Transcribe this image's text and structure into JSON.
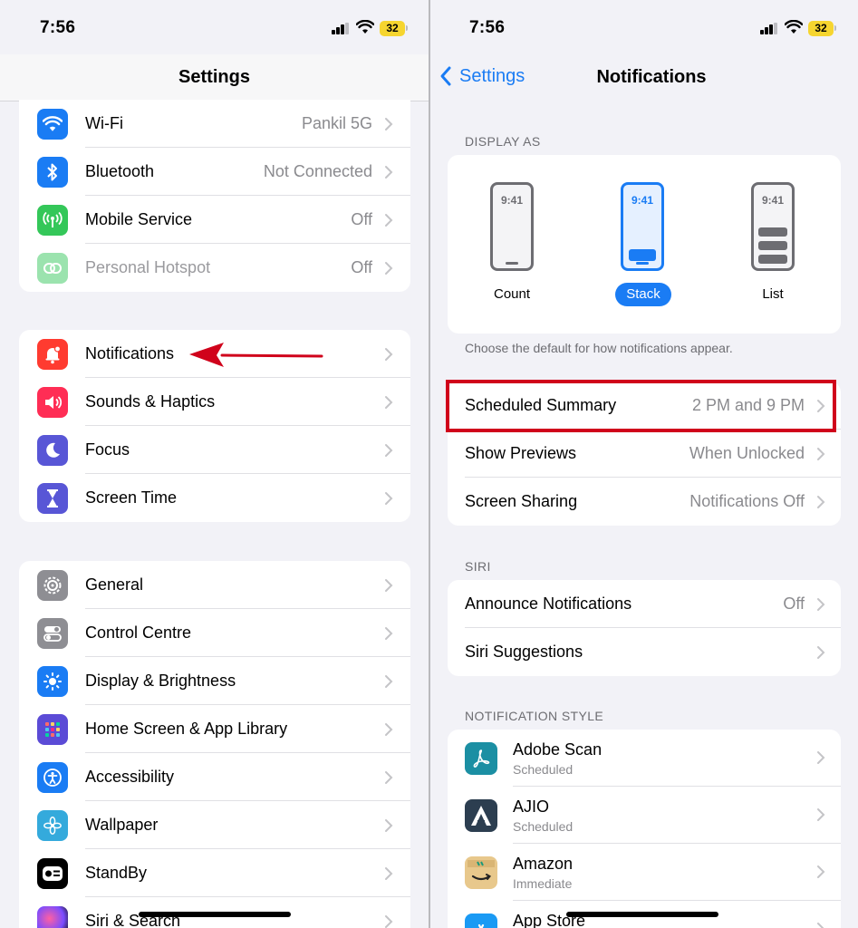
{
  "left": {
    "status": {
      "time": "7:56",
      "battery": "32"
    },
    "title": "Settings",
    "group1": [
      {
        "label": "Wi-Fi",
        "value": "Pankil 5G",
        "icon": "wifi-icon",
        "color": "#1a7cf4"
      },
      {
        "label": "Bluetooth",
        "value": "Not Connected",
        "icon": "bluetooth-icon",
        "color": "#1a7cf4"
      },
      {
        "label": "Mobile Service",
        "value": "Off",
        "icon": "antenna-icon",
        "color": "#34c759"
      },
      {
        "label": "Personal Hotspot",
        "value": "Off",
        "icon": "hotspot-icon",
        "color": "#34c759"
      }
    ],
    "group2": [
      {
        "label": "Notifications",
        "icon": "bell-icon",
        "color": "#ff3b30"
      },
      {
        "label": "Sounds & Haptics",
        "icon": "speaker-icon",
        "color": "#ff2d55"
      },
      {
        "label": "Focus",
        "icon": "moon-icon",
        "color": "#5856d6"
      },
      {
        "label": "Screen Time",
        "icon": "hourglass-icon",
        "color": "#5856d6"
      }
    ],
    "group3": [
      {
        "label": "General",
        "icon": "gear-icon",
        "color": "#8e8e93"
      },
      {
        "label": "Control Centre",
        "icon": "toggles-icon",
        "color": "#8e8e93"
      },
      {
        "label": "Display & Brightness",
        "icon": "sun-icon",
        "color": "#1a7cf4"
      },
      {
        "label": "Home Screen & App Library",
        "icon": "grid-icon",
        "color": "#5b4bd6"
      },
      {
        "label": "Accessibility",
        "icon": "accessibility-icon",
        "color": "#1a7cf4"
      },
      {
        "label": "Wallpaper",
        "icon": "flower-icon",
        "color": "#34aadc"
      },
      {
        "label": "StandBy",
        "icon": "standby-icon",
        "color": "#000000"
      },
      {
        "label": "Siri & Search",
        "icon": "siri-icon",
        "color": "#222222"
      }
    ]
  },
  "right": {
    "status": {
      "time": "7:56",
      "battery": "32"
    },
    "back_label": "Settings",
    "title": "Notifications",
    "display_as_header": "DISPLAY AS",
    "display_options": [
      {
        "label": "Count",
        "mock_time": "9:41"
      },
      {
        "label": "Stack",
        "mock_time": "9:41"
      },
      {
        "label": "List",
        "mock_time": "9:41"
      }
    ],
    "display_footnote": "Choose the default for how notifications appear.",
    "group1": [
      {
        "label": "Scheduled Summary",
        "value": "2 PM and 9 PM"
      },
      {
        "label": "Show Previews",
        "value": "When Unlocked"
      },
      {
        "label": "Screen Sharing",
        "value": "Notifications Off"
      }
    ],
    "siri_header": "SIRI",
    "siri_rows": [
      {
        "label": "Announce Notifications",
        "value": "Off"
      },
      {
        "label": "Siri Suggestions",
        "value": ""
      }
    ],
    "style_header": "NOTIFICATION STYLE",
    "apps": [
      {
        "name": "Adobe Scan",
        "sub": "Scheduled",
        "icon": "adobe-scan-icon",
        "color": "#1b8fa3"
      },
      {
        "name": "AJIO",
        "sub": "Scheduled",
        "icon": "ajio-icon",
        "color": "#2c3e50"
      },
      {
        "name": "Amazon",
        "sub": "Immediate",
        "icon": "amazon-icon",
        "color": "#e8c88c"
      },
      {
        "name": "App Store",
        "sub": "",
        "icon": "app-store-icon",
        "color": "#1a9af4"
      }
    ]
  }
}
